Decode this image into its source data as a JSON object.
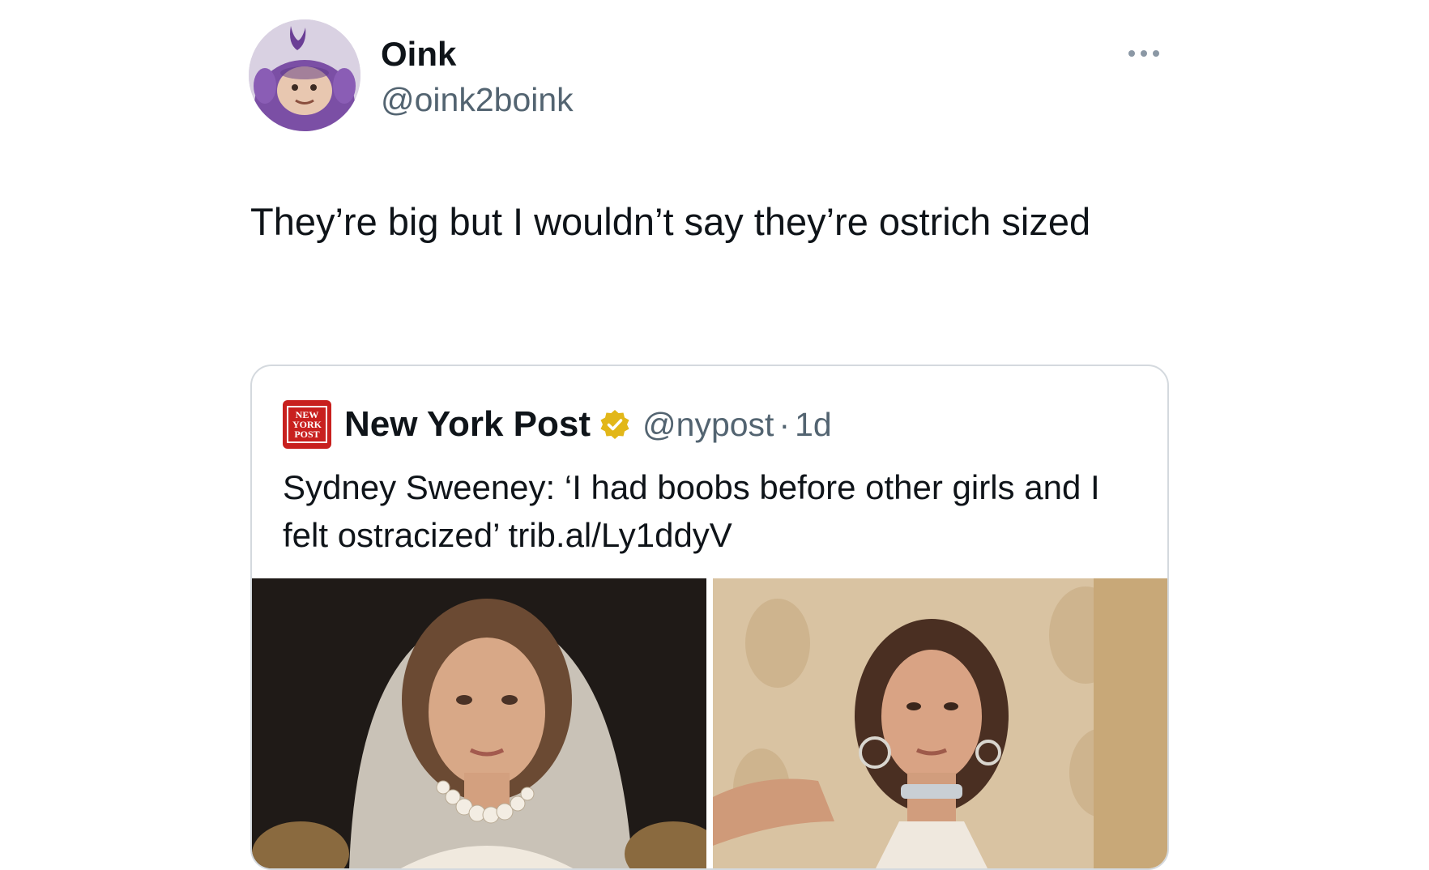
{
  "tweet": {
    "author_name": "Oink",
    "author_handle": "@oink2boink",
    "more_icon": "more-horizontal-icon",
    "text": "They’re big but I wouldn’t say they’re ostrich sized"
  },
  "quote": {
    "logo_icon": "new-york-post-logo",
    "name": "New York Post",
    "badge_icon": "verified-badge-icon",
    "badge_color": "#e2b719",
    "handle": "@nypost",
    "separator": "·",
    "time": "1d",
    "text": "Sydney Sweeney: ‘I had boobs before other girls and I felt ostracized’ trib.al/Ly1ddyV",
    "media_count": 2
  },
  "colors": {
    "text_primary": "#0f1419",
    "text_secondary": "#536471",
    "card_border": "#d4d9de",
    "nypost_red": "#c8201e",
    "avatar_purple": "#7b4fa5"
  }
}
